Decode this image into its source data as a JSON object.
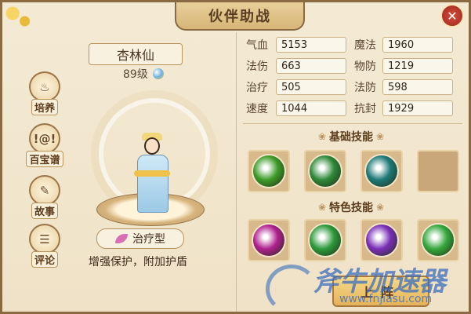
{
  "window": {
    "title": "伙伴助战",
    "close_glyph": "✕"
  },
  "nav": [
    {
      "label": "培养",
      "icon": "cultivate-icon",
      "glyph": "♨"
    },
    {
      "label": "百宝谱",
      "icon": "treasure-book-icon",
      "glyph": "!@!"
    },
    {
      "label": "故事",
      "icon": "story-scroll-icon",
      "glyph": "✎"
    },
    {
      "label": "评论",
      "icon": "comment-icon",
      "glyph": "☰"
    }
  ],
  "partner": {
    "name": "杏林仙",
    "level": "89级",
    "type": "治疗型",
    "description": "增强保护，附加护盾"
  },
  "stats": [
    [
      {
        "label": "气血",
        "value": "5153"
      },
      {
        "label": "魔法",
        "value": "1960"
      }
    ],
    [
      {
        "label": "法伤",
        "value": "663"
      },
      {
        "label": "物防",
        "value": "1219"
      }
    ],
    [
      {
        "label": "治疗",
        "value": "505"
      },
      {
        "label": "法防",
        "value": "598"
      }
    ],
    [
      {
        "label": "速度",
        "value": "1044"
      },
      {
        "label": "抗封",
        "value": "1929"
      }
    ]
  ],
  "sections": {
    "basic_skills": "基础技能",
    "special_skills": "特色技能"
  },
  "basic_skills": [
    {
      "icon": "green-leaf-skill-icon",
      "color": "#3f9c2a"
    },
    {
      "icon": "green-vine-skill-icon",
      "color": "#2f8a3a"
    },
    {
      "icon": "teal-spirit-skill-icon",
      "color": "#1f7a78"
    },
    {
      "icon": "empty-skill-slot",
      "color": ""
    }
  ],
  "special_skills": [
    {
      "icon": "magenta-orb-skill-icon",
      "color": "#b0208f"
    },
    {
      "icon": "green-burst-skill-icon",
      "color": "#2e9a3c"
    },
    {
      "icon": "purple-figure-skill-icon",
      "color": "#7b2fb8"
    },
    {
      "icon": "green-spark-skill-icon",
      "color": "#36a83e"
    }
  ],
  "actions": {
    "deploy": "上阵"
  },
  "watermark": {
    "brand": "斧牛加速器",
    "url": "www.fnjiasu.com"
  }
}
